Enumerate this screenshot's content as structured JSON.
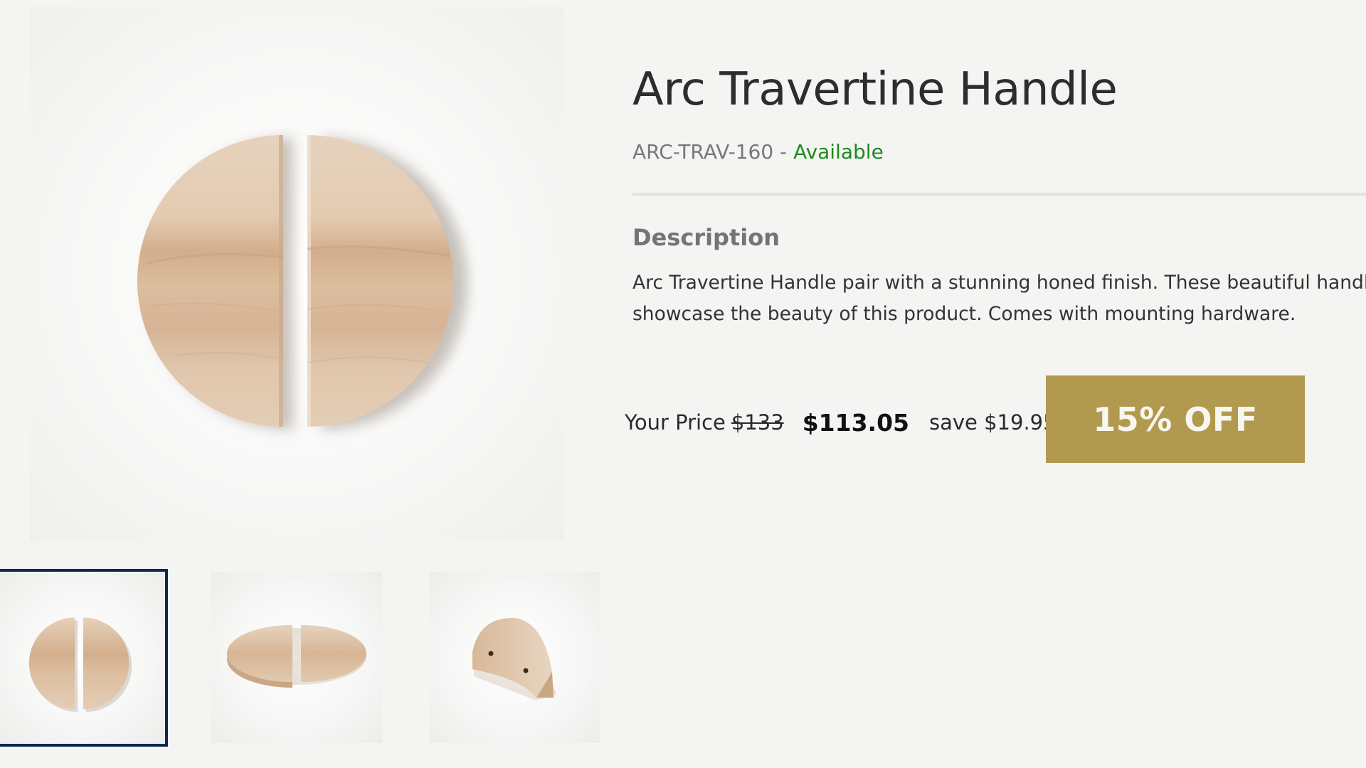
{
  "product": {
    "title": "Arc Travertine Handle",
    "sku": "ARC-TRAV-160",
    "separator": " - ",
    "availability": "Available",
    "description_heading": "Description",
    "description": "Arc Travertine Handle pair with a stunning honed finish. These beautiful handles showcase the beauty of this product. Comes with mounting hardware."
  },
  "pricing": {
    "label": "Your Price",
    "original_price": "$133",
    "current_price": "$113.05",
    "savings": "save $19.95",
    "discount_badge": "15% OFF"
  },
  "gallery": {
    "selected_index": 0,
    "thumbnails": [
      {
        "view": "front"
      },
      {
        "view": "angled"
      },
      {
        "view": "side"
      }
    ]
  },
  "colors": {
    "background": "#f4f4f2",
    "available": "#1f8a1f",
    "badge": "#b19a4f",
    "selected_thumb_border": "#0f2650",
    "stone": "#dcc0a4"
  }
}
